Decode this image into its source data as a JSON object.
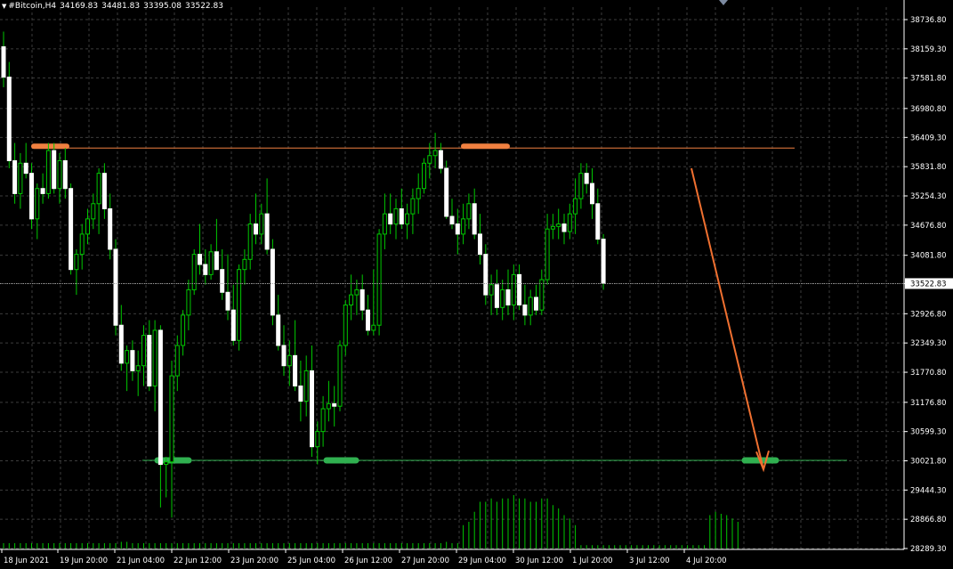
{
  "header": {
    "symbol": "#Bitcoin,H4",
    "open": "34169.83",
    "high": "34481.83",
    "low": "33395.08",
    "close": "33522.83"
  },
  "colors": {
    "background": "#000000",
    "grid": "#3c3c3c",
    "bull": "#ffffff",
    "bear": "#ffffff",
    "wick": "#00c800",
    "volume": "#00c800",
    "resistance": "#f08040",
    "support": "#30b050",
    "arrow": "#f07030",
    "price_line": "#a0a0a0",
    "text": "#ffffff"
  },
  "chart_data": {
    "type": "candlestick",
    "y_ticks": [
      "38736.80",
      "38159.30",
      "37581.80",
      "36980.80",
      "36409.30",
      "35831.80",
      "35254.30",
      "34676.80",
      "34081.80",
      "33522.83",
      "32926.80",
      "32349.30",
      "31770.80",
      "31176.80",
      "30599.30",
      "30021.80",
      "29444.30",
      "28866.80",
      "28289.30"
    ],
    "ylim": [
      28289.3,
      39000
    ],
    "x_ticks": [
      "18 Jun 2021",
      "19 Jun 20:00",
      "21 Jun 04:00",
      "22 Jun 12:00",
      "23 Jun 20:00",
      "25 Jun 04:00",
      "26 Jun 12:00",
      "27 Jun 20:00",
      "29 Jun 04:00",
      "30 Jun 12:00",
      "1 Jul 20:00",
      "3 Jul 12:00",
      "4 Jul 20:00"
    ],
    "current_price": 33522.83,
    "resistance": 36200,
    "support": 30030,
    "forecast": {
      "from_index": 121,
      "from_price": 35800,
      "to_index": 134,
      "to_price": 29850
    },
    "candles": [
      [
        38200,
        38500,
        37400,
        37600
      ],
      [
        37600,
        37900,
        35800,
        35950
      ],
      [
        35950,
        36300,
        35100,
        35300
      ],
      [
        35300,
        36100,
        35000,
        35900
      ],
      [
        35900,
        36300,
        35600,
        35700
      ],
      [
        35700,
        35900,
        34600,
        34800
      ],
      [
        34800,
        35500,
        34400,
        35400
      ],
      [
        35400,
        35700,
        35100,
        35300
      ],
      [
        35300,
        36300,
        35200,
        36150
      ],
      [
        36150,
        36300,
        35300,
        35400
      ],
      [
        35400,
        36100,
        35100,
        35950
      ],
      [
        35950,
        36200,
        35200,
        35400
      ],
      [
        35400,
        35500,
        33700,
        33800
      ],
      [
        33800,
        34200,
        33300,
        34100
      ],
      [
        34100,
        34700,
        33800,
        34500
      ],
      [
        34500,
        35000,
        34300,
        34800
      ],
      [
        34800,
        35300,
        34600,
        35100
      ],
      [
        35100,
        35800,
        34500,
        35700
      ],
      [
        35700,
        35900,
        34800,
        35000
      ],
      [
        35000,
        35300,
        34000,
        34200
      ],
      [
        34200,
        34400,
        32500,
        32700
      ],
      [
        32700,
        33100,
        31800,
        31950
      ],
      [
        31950,
        32300,
        31400,
        32200
      ],
      [
        32200,
        32400,
        31600,
        31800
      ],
      [
        31800,
        32200,
        31300,
        31900
      ],
      [
        31900,
        32700,
        31500,
        32500
      ],
      [
        32500,
        32800,
        31400,
        31500
      ],
      [
        31500,
        32800,
        31000,
        32600
      ],
      [
        32600,
        32700,
        29100,
        29950
      ],
      [
        29950,
        30100,
        29300,
        30000
      ],
      [
        30000,
        32000,
        28900,
        31700
      ],
      [
        31700,
        32500,
        31400,
        32300
      ],
      [
        32300,
        33000,
        32100,
        32900
      ],
      [
        32900,
        33600,
        32600,
        33400
      ],
      [
        33400,
        34200,
        33300,
        34100
      ],
      [
        34100,
        34700,
        33700,
        33900
      ],
      [
        33900,
        34200,
        33500,
        33700
      ],
      [
        33700,
        34300,
        33600,
        34150
      ],
      [
        34150,
        34800,
        33800,
        33800
      ],
      [
        33800,
        34200,
        33200,
        33350
      ],
      [
        33350,
        34100,
        32800,
        33000
      ],
      [
        33000,
        33500,
        32300,
        32400
      ],
      [
        32400,
        33900,
        32200,
        33800
      ],
      [
        33800,
        34200,
        33500,
        34000
      ],
      [
        34000,
        34900,
        33800,
        34700
      ],
      [
        34700,
        35300,
        34300,
        34500
      ],
      [
        34500,
        35100,
        34300,
        34900
      ],
      [
        34900,
        35600,
        34100,
        34200
      ],
      [
        34200,
        34400,
        32700,
        32900
      ],
      [
        32900,
        33300,
        32200,
        32300
      ],
      [
        32300,
        32700,
        31700,
        31900
      ],
      [
        31900,
        32400,
        31500,
        32100
      ],
      [
        32100,
        32800,
        31400,
        31500
      ],
      [
        31500,
        32000,
        30800,
        31200
      ],
      [
        31200,
        32100,
        30900,
        31800
      ],
      [
        31800,
        32300,
        30100,
        30300
      ],
      [
        30300,
        30800,
        29950,
        30600
      ],
      [
        30600,
        31300,
        30300,
        31050
      ],
      [
        31050,
        31600,
        30800,
        31150
      ],
      [
        31150,
        31500,
        30700,
        31100
      ],
      [
        31100,
        32400,
        31000,
        32300
      ],
      [
        32300,
        33200,
        32100,
        33100
      ],
      [
        33100,
        33700,
        32800,
        33300
      ],
      [
        33300,
        33600,
        32900,
        33400
      ],
      [
        33400,
        33700,
        32800,
        33000
      ],
      [
        33000,
        33300,
        32500,
        32600
      ],
      [
        32600,
        33800,
        32500,
        32700
      ],
      [
        32700,
        34600,
        32500,
        34500
      ],
      [
        34500,
        35300,
        34200,
        34900
      ],
      [
        34900,
        35300,
        34500,
        34700
      ],
      [
        34700,
        35200,
        34400,
        35000
      ],
      [
        35000,
        35400,
        34600,
        34700
      ],
      [
        34700,
        35100,
        34400,
        34900
      ],
      [
        34900,
        35400,
        34500,
        35200
      ],
      [
        35200,
        35700,
        34900,
        35400
      ],
      [
        35400,
        36000,
        35300,
        35900
      ],
      [
        35900,
        36300,
        35600,
        36050
      ],
      [
        36050,
        36500,
        35800,
        36150
      ],
      [
        36150,
        36300,
        35700,
        35800
      ],
      [
        35800,
        35950,
        34800,
        34850
      ],
      [
        34850,
        35200,
        34600,
        34700
      ],
      [
        34700,
        35000,
        34100,
        34500
      ],
      [
        34500,
        35100,
        34300,
        34800
      ],
      [
        34800,
        35300,
        34600,
        35100
      ],
      [
        35100,
        35400,
        34400,
        34500
      ],
      [
        34500,
        34900,
        33900,
        34100
      ],
      [
        34100,
        34300,
        33100,
        33300
      ],
      [
        33300,
        33700,
        32900,
        33500
      ],
      [
        33500,
        33800,
        32900,
        33050
      ],
      [
        33050,
        33600,
        32800,
        33400
      ],
      [
        33400,
        33800,
        32900,
        33100
      ],
      [
        33100,
        33900,
        32800,
        33700
      ],
      [
        33700,
        33900,
        33000,
        33100
      ],
      [
        33100,
        33500,
        32700,
        32900
      ],
      [
        32900,
        33400,
        32700,
        33250
      ],
      [
        33250,
        33500,
        32900,
        33000
      ],
      [
        33000,
        33800,
        32900,
        33600
      ],
      [
        33600,
        34900,
        33500,
        34600
      ],
      [
        34600,
        34900,
        34400,
        34650
      ],
      [
        34650,
        35000,
        34400,
        34700
      ],
      [
        34700,
        34900,
        34300,
        34550
      ],
      [
        34550,
        35100,
        34400,
        34900
      ],
      [
        34900,
        35600,
        34500,
        35200
      ],
      [
        35200,
        35900,
        35000,
        35700
      ],
      [
        35700,
        35900,
        35300,
        35500
      ],
      [
        35500,
        35800,
        34800,
        35100
      ],
      [
        35100,
        35400,
        34300,
        34400
      ],
      [
        34400,
        34500,
        33400,
        33530
      ]
    ],
    "volumes": [
      0.08,
      0.08,
      0.08,
      0.08,
      0.08,
      0.08,
      0.08,
      0.08,
      0.08,
      0.08,
      0.08,
      0.08,
      0.08,
      0.08,
      0.08,
      0.08,
      0.08,
      0.08,
      0.08,
      0.08,
      0.08,
      0.1,
      0.1,
      0.08,
      0.08,
      0.08,
      0.08,
      0.08,
      0.08,
      0.08,
      0.08,
      0.08,
      0.08,
      0.08,
      0.08,
      0.08,
      0.08,
      0.08,
      0.08,
      0.08,
      0.08,
      0.08,
      0.08,
      0.08,
      0.08,
      0.08,
      0.08,
      0.08,
      0.08,
      0.08,
      0.08,
      0.08,
      0.08,
      0.08,
      0.08,
      0.08,
      0.08,
      0.08,
      0.08,
      0.08,
      0.08,
      0.08,
      0.08,
      0.08,
      0.08,
      0.08,
      0.08,
      0.08,
      0.08,
      0.08,
      0.08,
      0.08,
      0.08,
      0.08,
      0.08,
      0.08,
      0.08,
      0.08,
      0.08,
      0.1,
      0.08,
      0.08,
      0.35,
      0.4,
      0.55,
      0.7,
      0.7,
      0.75,
      0.7,
      0.75,
      0.75,
      0.8,
      0.75,
      0.75,
      0.7,
      0.7,
      0.75,
      0.75,
      0.65,
      0.6,
      0.5,
      0.45,
      0.35,
      0.05,
      0.05,
      0.05,
      0.05,
      0.05,
      0.05,
      0.05,
      0.05,
      0.05,
      0.05,
      0.05,
      0.05,
      0.05,
      0.05,
      0.05,
      0.05,
      0.05,
      0.05,
      0.05,
      0.05,
      0.05,
      0.05,
      0.05,
      0.5,
      0.55,
      0.52,
      0.5,
      0.45,
      0.4
    ]
  }
}
